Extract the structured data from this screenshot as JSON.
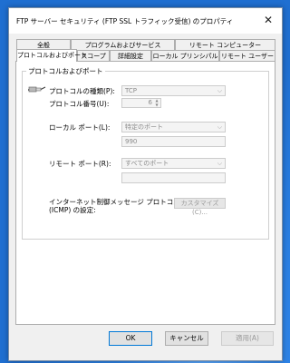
{
  "window": {
    "title": "FTP サーバー セキュリティ (FTP SSL トラフィック受信) のプロパティ",
    "close_glyph": "✕"
  },
  "tabs_row1": [
    {
      "label": "全般"
    },
    {
      "label": "プログラムおよびサービス"
    },
    {
      "label": "リモート コンピューター"
    }
  ],
  "tabs_row2": [
    {
      "label": "プロトコルおよびポート",
      "active": true
    },
    {
      "label": "スコープ"
    },
    {
      "label": "詳細設定"
    },
    {
      "label": "ローカル プリンシパル"
    },
    {
      "label": "リモート ユーザー"
    }
  ],
  "group": {
    "legend": "プロトコルおよびポート",
    "protocol_type_label": "プロトコルの種類(P):",
    "protocol_type_value": "TCP",
    "protocol_number_label": "プロトコル番号(U):",
    "protocol_number_value": "6",
    "local_port_label": "ローカル ポート(L):",
    "local_port_value": "特定のポート",
    "local_port_number": "990",
    "remote_port_label": "リモート ポート(R):",
    "remote_port_value": "すべてのポート",
    "remote_port_number": "",
    "icmp_label_line1": "インターネット制御メッセージ プロトコル",
    "icmp_label_line2": "(ICMP) の設定:",
    "customize_button": "カスタマイズ(C)..."
  },
  "buttons": {
    "ok": "OK",
    "cancel": "キャンセル",
    "apply": "適用(A)"
  },
  "icons": {
    "protocol": "network-plug-icon",
    "dropdown": "chevron-down-icon"
  }
}
